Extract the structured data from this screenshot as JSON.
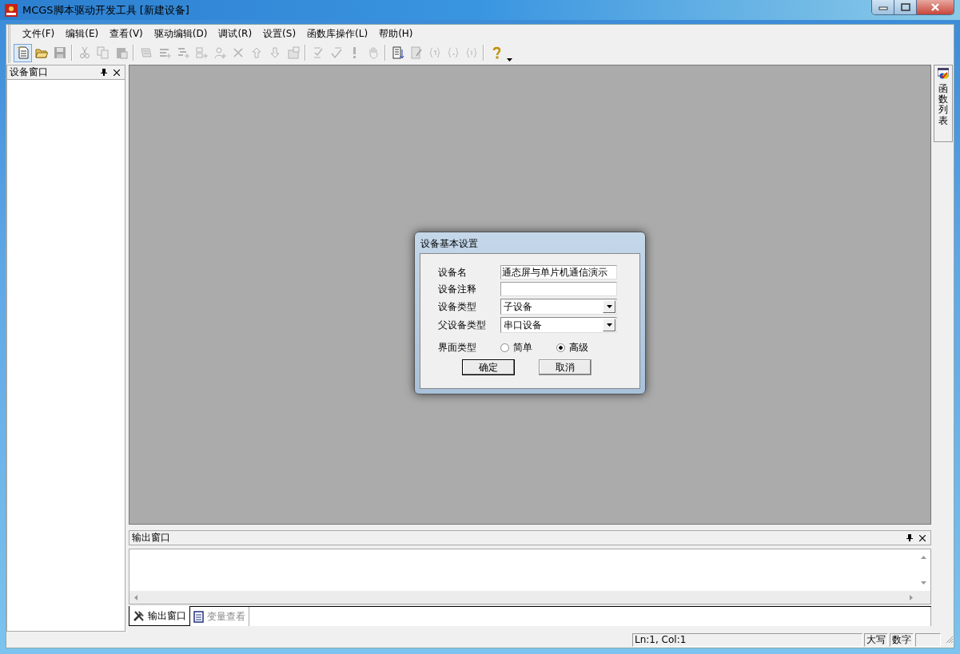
{
  "window": {
    "title": "MCGS脚本驱动开发工具 [新建设备]"
  },
  "menu": [
    "文件(F)",
    "编辑(E)",
    "查看(V)",
    "驱动编辑(D)",
    "调试(R)",
    "设置(S)",
    "函数库操作(L)",
    "帮助(H)"
  ],
  "toolbar": [
    [
      {
        "disabled": false
      },
      {
        "disabled": false
      },
      {
        "disabled": true
      }
    ],
    [
      {
        "disabled": true
      },
      {
        "disabled": true
      },
      {
        "disabled": true
      }
    ],
    [
      {
        "disabled": true
      },
      {
        "disabled": true
      },
      {
        "disabled": true
      },
      {
        "disabled": true
      },
      {
        "disabled": true
      },
      {
        "disabled": true
      },
      {
        "disabled": true
      },
      {
        "disabled": true
      },
      {
        "disabled": true
      }
    ],
    [
      {
        "disabled": true
      },
      {
        "disabled": true
      },
      {
        "disabled": true
      },
      {
        "disabled": true
      }
    ],
    [
      {
        "disabled": false
      },
      {
        "disabled": true
      },
      {
        "disabled": true
      },
      {
        "disabled": true
      },
      {
        "disabled": true
      }
    ],
    [
      {
        "disabled": false
      }
    ]
  ],
  "device_panel": {
    "title": "设备窗口"
  },
  "side_tab": {
    "label": "函数列表"
  },
  "dialog": {
    "title": "设备基本设置",
    "fields": [
      {
        "kind": "text",
        "label": "设备名",
        "value": "通态屏与单片机通信演示"
      },
      {
        "kind": "text",
        "label": "设备注释"
      },
      {
        "kind": "combo",
        "label": "设备类型",
        "value": "子设备"
      },
      {
        "kind": "combo",
        "label": "父设备类型",
        "value": "串口设备"
      }
    ],
    "interface": {
      "label": "界面类型",
      "options": [
        {
          "label": "简单",
          "selected": false
        },
        {
          "label": "高级",
          "selected": true
        }
      ]
    },
    "buttons": [
      "确定",
      "取消"
    ]
  },
  "output_panel": {
    "title": "输出窗口"
  },
  "bottom_tabs": [
    {
      "label": "输出窗口",
      "selected": true
    },
    {
      "label": "变量查看",
      "selected": false
    }
  ],
  "status_bar": {
    "position": "Ln:1, Col:1",
    "caps": "大写",
    "num": "数字"
  }
}
